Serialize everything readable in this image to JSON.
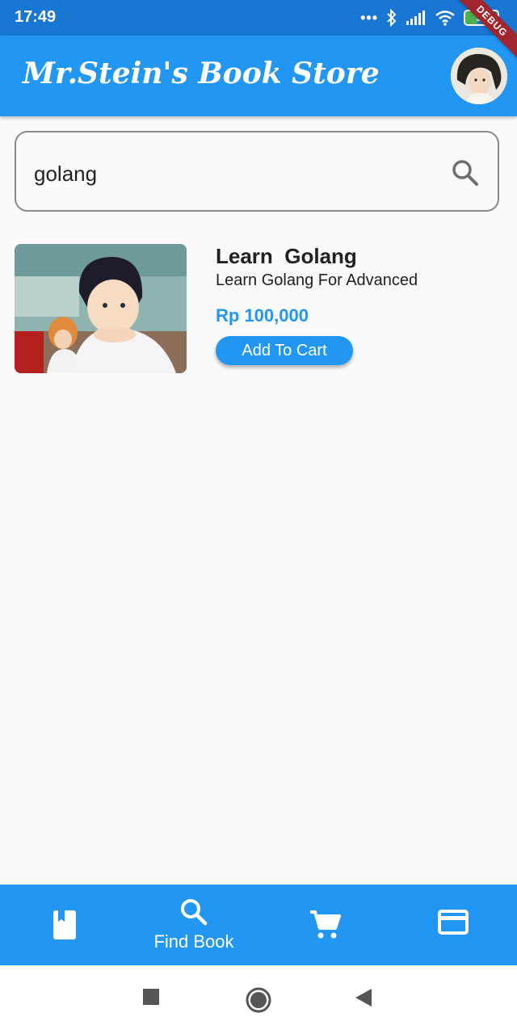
{
  "status_bar": {
    "time": "17:49",
    "battery": "37",
    "battery_level": 0.37,
    "debug_banner": "DEBUG"
  },
  "app_bar": {
    "title": "Mr.Stein's Book Store",
    "avatar_icon": "profile-avatar"
  },
  "search": {
    "value": "golang",
    "placeholder": ""
  },
  "results": [
    {
      "title": "Learn  Golang",
      "subtitle": "Learn Golang For Advanced",
      "price": "Rp 100,000",
      "button_label": "Add To Cart"
    }
  ],
  "bottom_nav": {
    "items": [
      {
        "icon": "book-icon",
        "label": ""
      },
      {
        "icon": "search-icon",
        "label": "Find Book",
        "active": true
      },
      {
        "icon": "cart-icon",
        "label": ""
      },
      {
        "icon": "credit-card-icon",
        "label": ""
      }
    ]
  },
  "colors": {
    "primary": "#2196f3",
    "status_bar": "#1976d2",
    "price": "#2196f3",
    "debug": "#a0252d"
  }
}
